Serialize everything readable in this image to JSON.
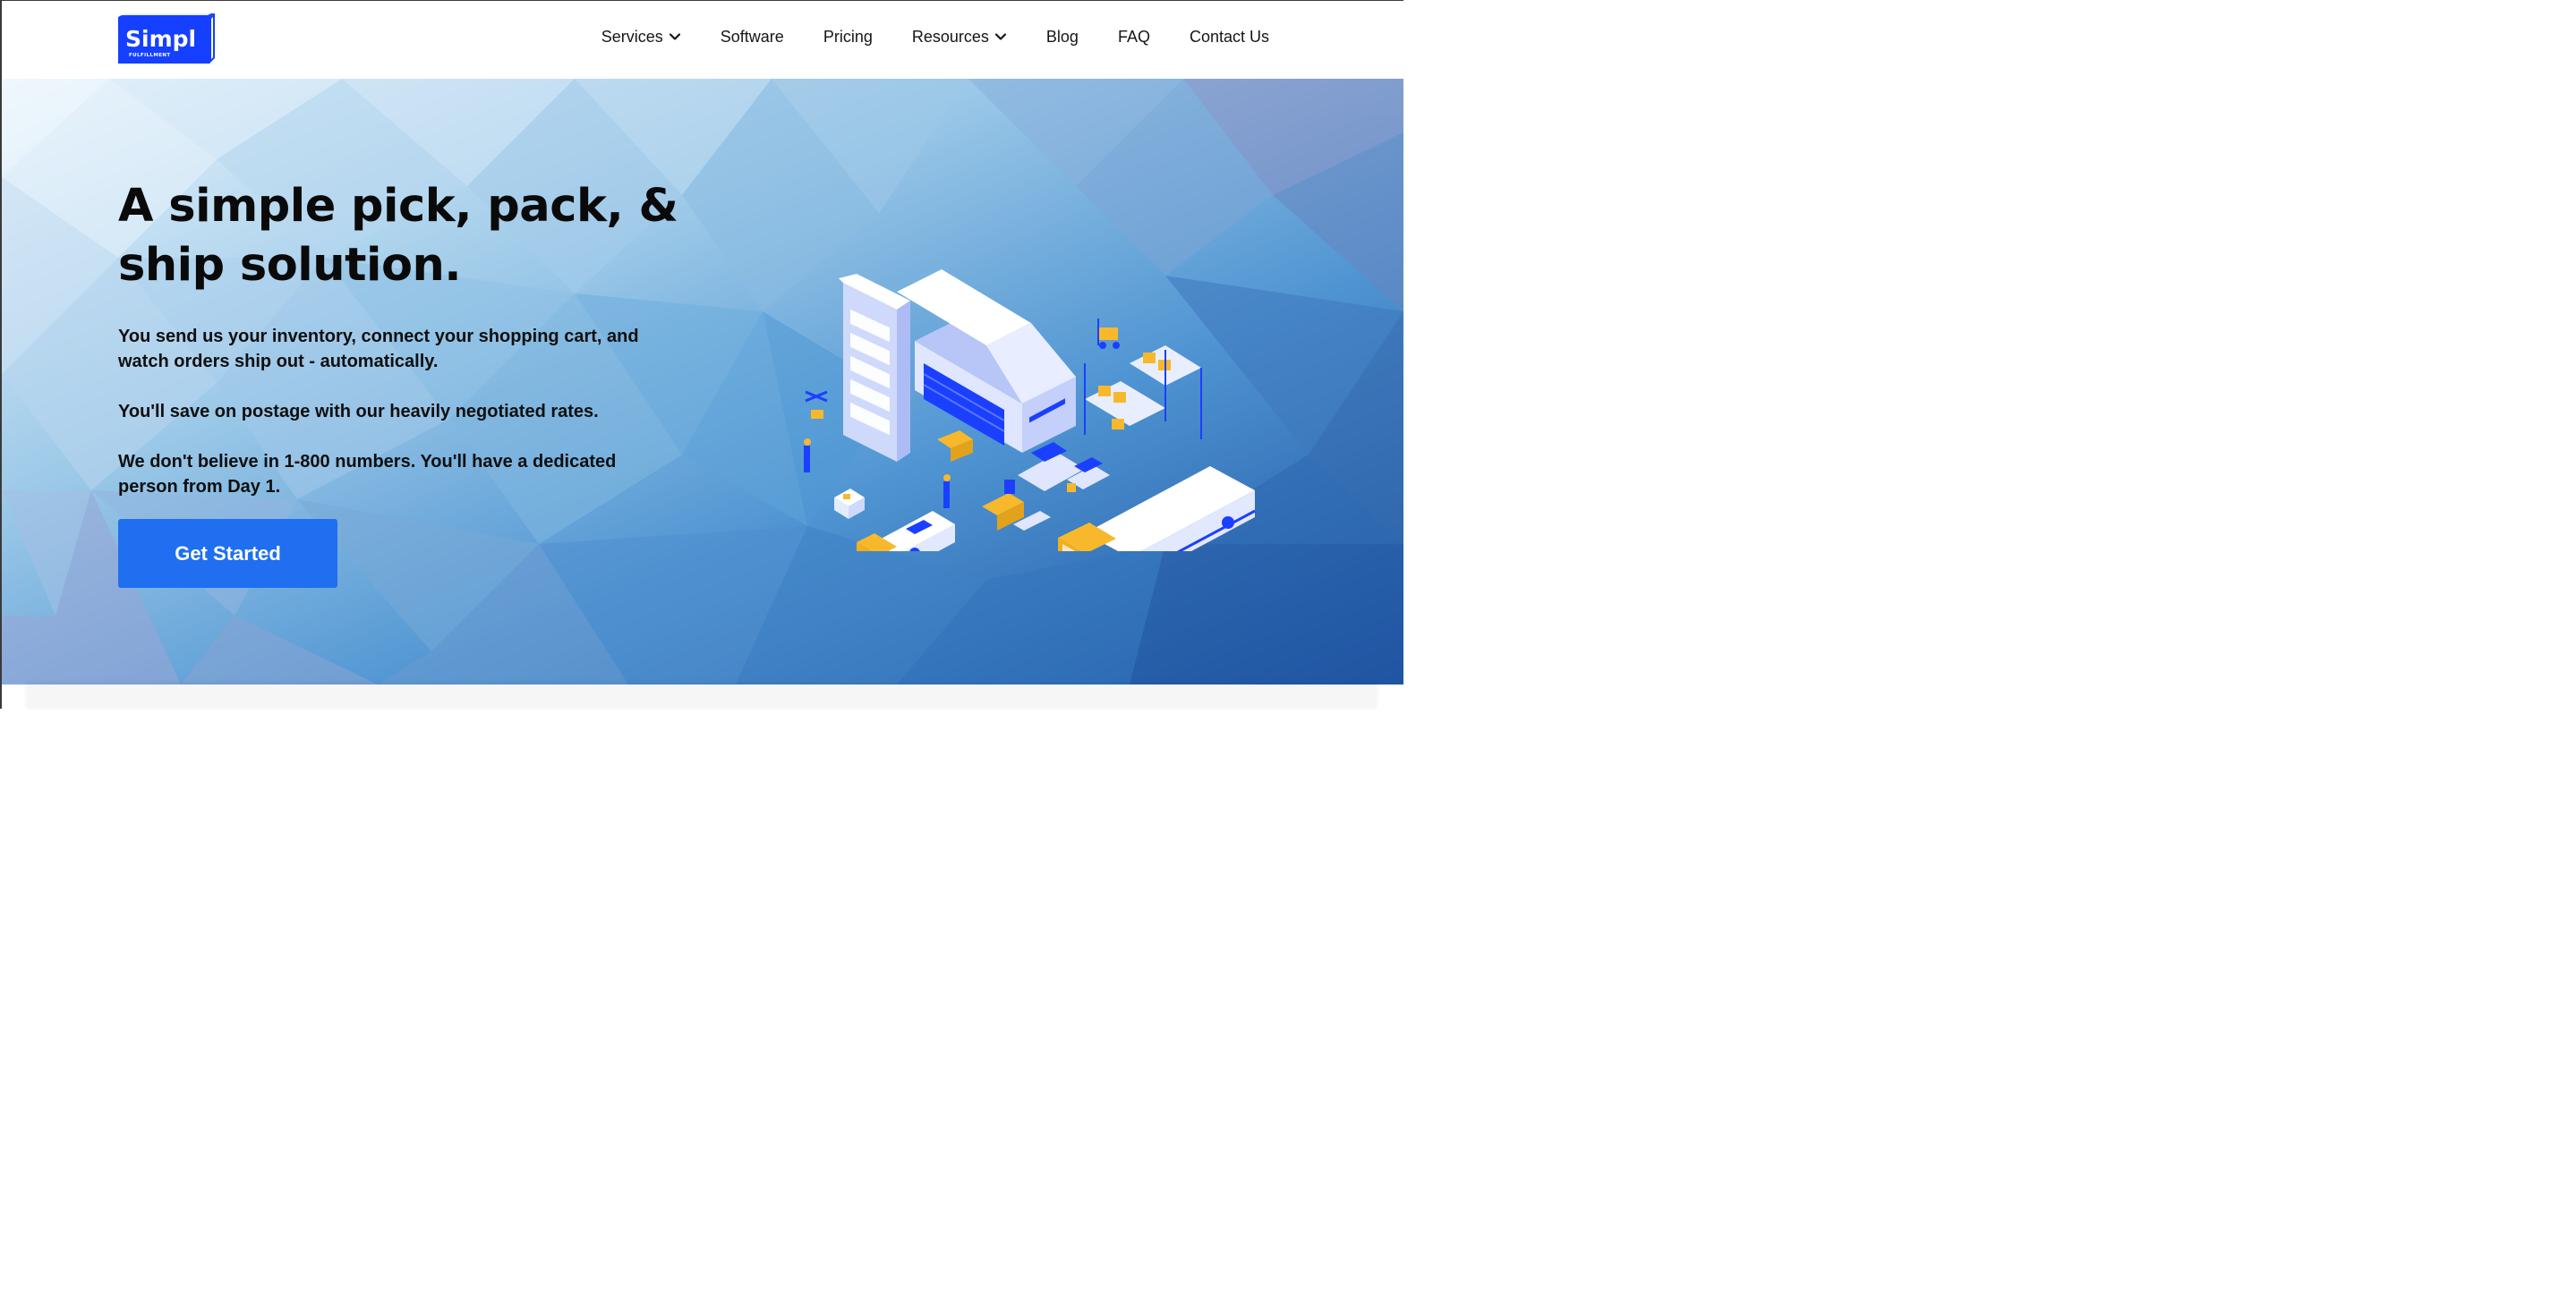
{
  "brand": {
    "logo_word": "Simpl",
    "logo_sub": "FULFILLMENT",
    "logo_color": "#1540ff"
  },
  "nav": {
    "items": [
      {
        "label": "Services",
        "has_dropdown": true
      },
      {
        "label": "Software",
        "has_dropdown": false
      },
      {
        "label": "Pricing",
        "has_dropdown": false
      },
      {
        "label": "Resources",
        "has_dropdown": true
      },
      {
        "label": "Blog",
        "has_dropdown": false
      },
      {
        "label": "FAQ",
        "has_dropdown": false
      },
      {
        "label": "Contact Us",
        "has_dropdown": false
      }
    ]
  },
  "hero": {
    "headline_line1": "A simple pick, pack, &",
    "headline_line2": "ship solution.",
    "paragraphs": [
      "You send us your inventory, connect your shopping cart, and watch orders ship out - automatically.",
      "You'll save on postage with our heavily negotiated rates.",
      "We don't believe in 1-800 numbers. You'll have a dedicated person from Day 1."
    ],
    "cta_label": "Get Started",
    "illustration_icon": "warehouse-logistics-illustration",
    "colors": {
      "cta": "#1f6ff0",
      "background_light": "#e3f0fb",
      "background_dark": "#1d55a8",
      "illustration_blue": "#1b3fff",
      "illustration_yellow": "#f7b92b"
    }
  }
}
